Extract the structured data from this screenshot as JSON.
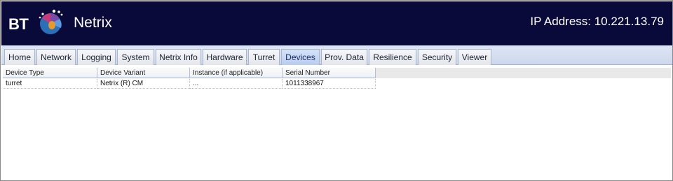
{
  "header": {
    "logo_text": "BT",
    "brand": "Netrix",
    "ip_label": "IP Address: 10.221.13.79"
  },
  "tabs": [
    {
      "label": "Home"
    },
    {
      "label": "Network"
    },
    {
      "label": "Logging"
    },
    {
      "label": "System"
    },
    {
      "label": "Netrix Info"
    },
    {
      "label": "Hardware"
    },
    {
      "label": "Turret"
    },
    {
      "label": "Devices",
      "active": true
    },
    {
      "label": "Prov. Data"
    },
    {
      "label": "Resilience"
    },
    {
      "label": "Security"
    },
    {
      "label": "Viewer"
    }
  ],
  "grid": {
    "columns": [
      "Device Type",
      "Device Variant",
      "Instance (if applicable)",
      "Serial Number"
    ],
    "rows": [
      [
        "turret",
        "Netrix (R) CM",
        "...",
        "1011338967"
      ]
    ]
  },
  "colors": {
    "header_bg": "#0a0a3a",
    "tab_active": "#b9cdef",
    "globe_blue": "#2a6fb8",
    "globe_purple": "#7a4aa6",
    "globe_orange": "#e59a2c"
  }
}
